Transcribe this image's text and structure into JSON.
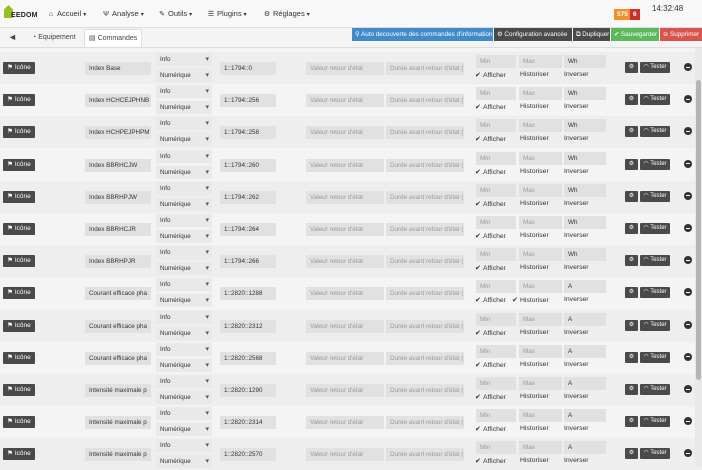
{
  "header": {
    "logo_text": "EEDOM",
    "menu": [
      {
        "label": "Accueil",
        "icon": "home-icon",
        "glyph": "⌂"
      },
      {
        "label": "Analyse",
        "icon": "dashboard-icon",
        "glyph": "Ψ"
      },
      {
        "label": "Outils",
        "icon": "wrench-icon",
        "glyph": "✎"
      },
      {
        "label": "Plugins",
        "icon": "list-icon",
        "glyph": "☰"
      },
      {
        "label": "Réglages",
        "icon": "gear-icon",
        "glyph": "⚙"
      }
    ],
    "badge_orange": "575",
    "badge_red": "6",
    "time": "14:32:48",
    "colors": {
      "orange": "#f0902d",
      "red": "#c9302c"
    }
  },
  "tabs": {
    "back_icon": "arrow-left-icon",
    "equipment": "Equipement",
    "commands": "Commandes"
  },
  "actions": {
    "auto_discover": "Auto decouverte des commandes d'information",
    "advanced_config": "Configuration avancée",
    "duplicate": "Dupliquer",
    "save": "Sauvegarder",
    "delete": "Supprimer",
    "colors": {
      "blue": "#428bca",
      "dark": "#4a4a4a",
      "green": "#5cb85c",
      "red": "#d9534f"
    }
  },
  "labels": {
    "icon_button": "Icône",
    "state_return_placeholder": "Valeur retour d'état",
    "state_delay_placeholder": "Durée avant retour d'état (",
    "min_placeholder": "Min",
    "max_placeholder": "Max",
    "show": "Afficher",
    "historize": "Historiser",
    "invert": "Inverser",
    "test": "Tester"
  },
  "commands": [
    {
      "name": "Index Base",
      "type": "Info",
      "subtype": "Numérique",
      "address": "1::1794::0",
      "unit": "Wh",
      "historize": false
    },
    {
      "name": "Index HCHCEJPHNB",
      "type": "Info",
      "subtype": "Numérique",
      "address": "1::1794::256",
      "unit": "Wh",
      "historize": false
    },
    {
      "name": "Index HCHPEJPHPM",
      "type": "Info",
      "subtype": "Numérique",
      "address": "1::1794::258",
      "unit": "Wh",
      "historize": false
    },
    {
      "name": "Index BBRHCJW",
      "type": "Info",
      "subtype": "Numérique",
      "address": "1::1794::260",
      "unit": "Wh",
      "historize": false
    },
    {
      "name": "Index BBRHPJW",
      "type": "Info",
      "subtype": "Numérique",
      "address": "1::1794::262",
      "unit": "Wh",
      "historize": false
    },
    {
      "name": "Index BBRHCJR",
      "type": "Info",
      "subtype": "Numérique",
      "address": "1::1794::264",
      "unit": "Wh",
      "historize": false
    },
    {
      "name": "Index BBRHPJR",
      "type": "Info",
      "subtype": "Numérique",
      "address": "1::1794::266",
      "unit": "Wh",
      "historize": false
    },
    {
      "name": "Courant efficace pha",
      "type": "Info",
      "subtype": "Numérique",
      "address": "1::2820::1288",
      "unit": "A",
      "historize": true
    },
    {
      "name": "Courant efficace pha",
      "type": "Info",
      "subtype": "Numérique",
      "address": "1::2820::2312",
      "unit": "A",
      "historize": false
    },
    {
      "name": "Courant efficace pha",
      "type": "Info",
      "subtype": "Numérique",
      "address": "1::2820::2568",
      "unit": "A",
      "historize": false
    },
    {
      "name": "Intensité maximale p",
      "type": "Info",
      "subtype": "Numérique",
      "address": "1::2820::1290",
      "unit": "A",
      "historize": false
    },
    {
      "name": "Intensité maximale p",
      "type": "Info",
      "subtype": "Numérique",
      "address": "1::2820::2314",
      "unit": "A",
      "historize": false
    },
    {
      "name": "Intensité maximale p",
      "type": "Info",
      "subtype": "Numérique",
      "address": "1::2820::2570",
      "unit": "A",
      "historize": false
    }
  ]
}
